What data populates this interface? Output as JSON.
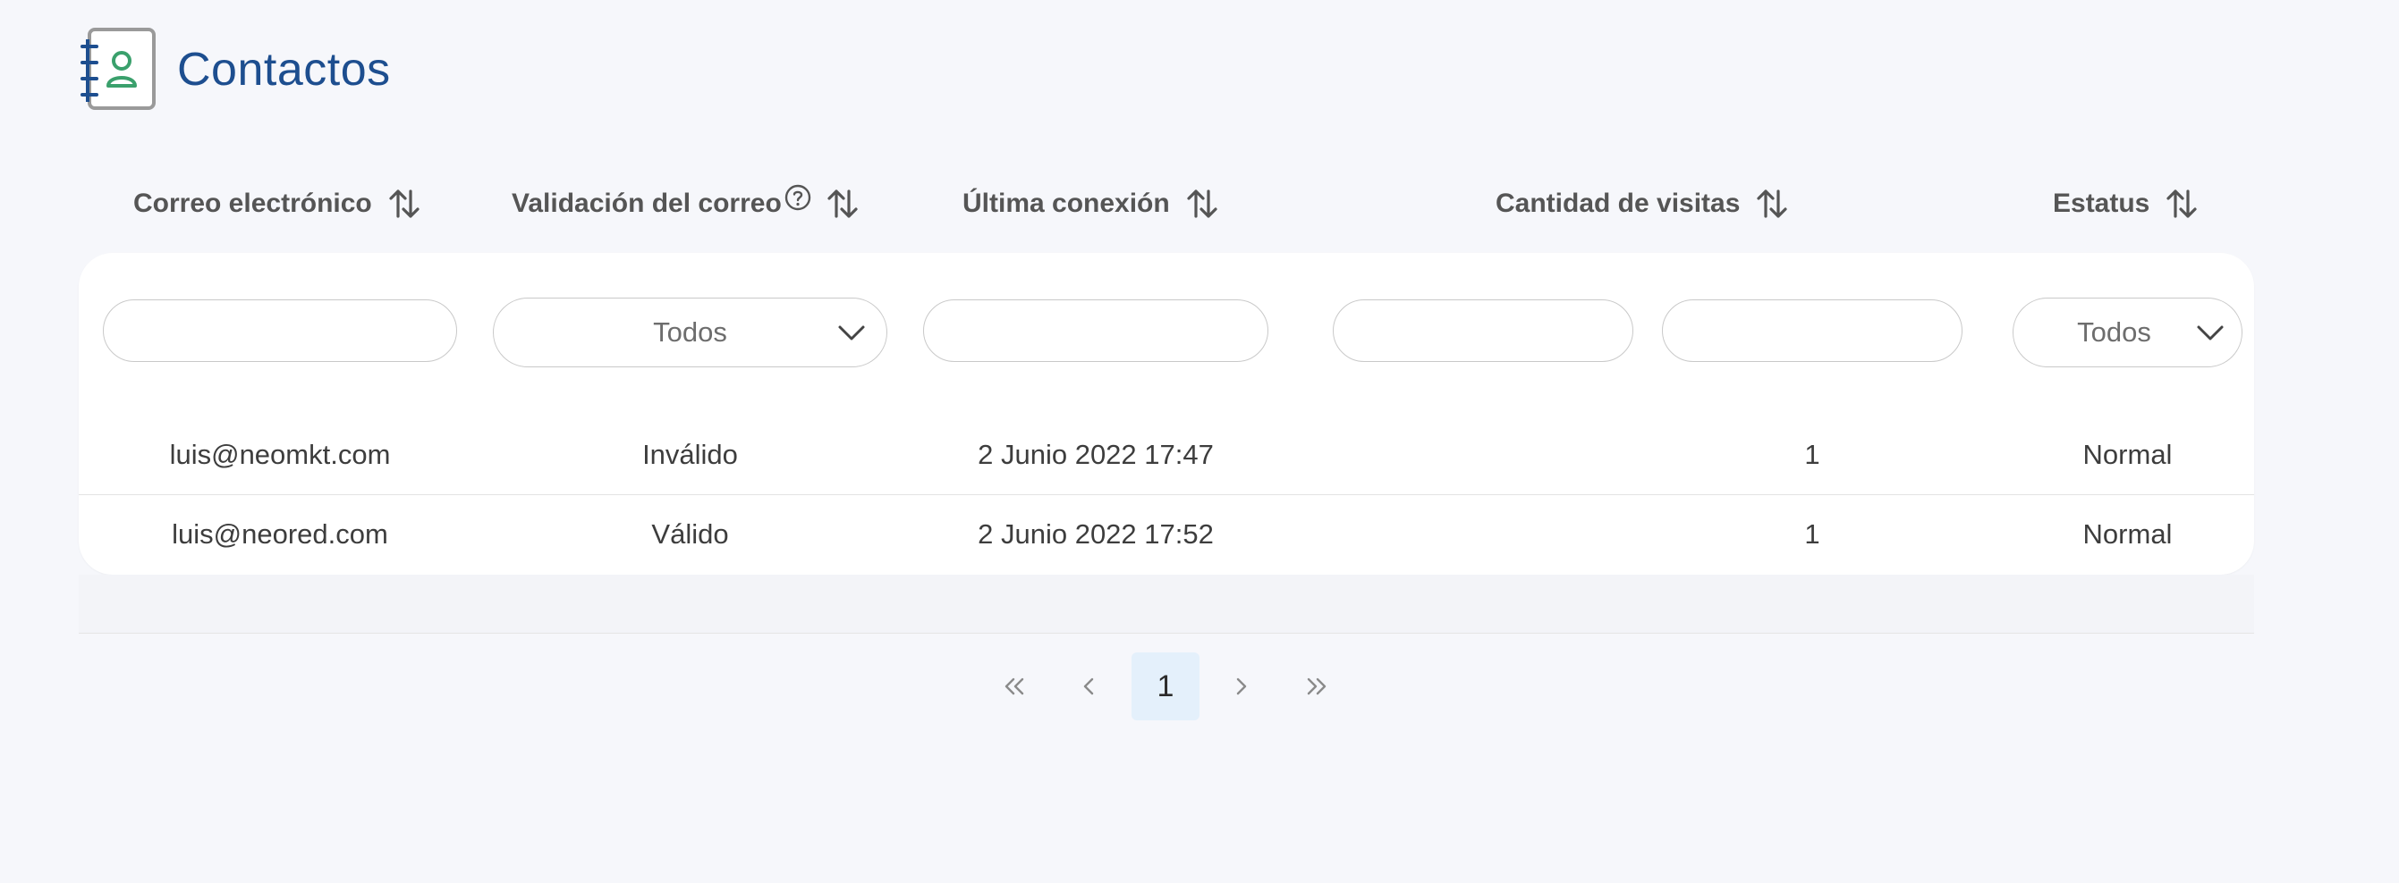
{
  "page": {
    "title": "Contactos",
    "icon": "contact-book-icon",
    "title_color": "#1d4e8f"
  },
  "table": {
    "headers": [
      {
        "label": "Correo electrónico",
        "sortable": true
      },
      {
        "label": "Validación del correo",
        "sortable": true,
        "help_icon": "question-circle-icon"
      },
      {
        "label": "Última conexión",
        "sortable": true
      },
      {
        "label": "Cantidad de visitas",
        "sortable": true
      },
      {
        "label": "Estatus",
        "sortable": true
      }
    ],
    "filters": {
      "email": "",
      "validation": {
        "selected": "Todos"
      },
      "last_connection": "",
      "visits_min": "",
      "visits_max": "",
      "status": {
        "selected": "Todos"
      }
    },
    "rows": [
      {
        "email": "luis@neomkt.com",
        "validation": "Inválido",
        "last_connection": "2 Junio 2022 17:47",
        "visits": "1",
        "status": "Normal"
      },
      {
        "email": "luis@neored.com",
        "validation": "Válido",
        "last_connection": "2 Junio 2022 17:52",
        "visits": "1",
        "status": "Normal"
      }
    ]
  },
  "pagination": {
    "first_icon": "double-chevron-left-icon",
    "prev_icon": "chevron-left-icon",
    "current_page": "1",
    "next_icon": "chevron-right-icon",
    "last_icon": "double-chevron-right-icon",
    "active_bg": "#e4f0fb"
  }
}
